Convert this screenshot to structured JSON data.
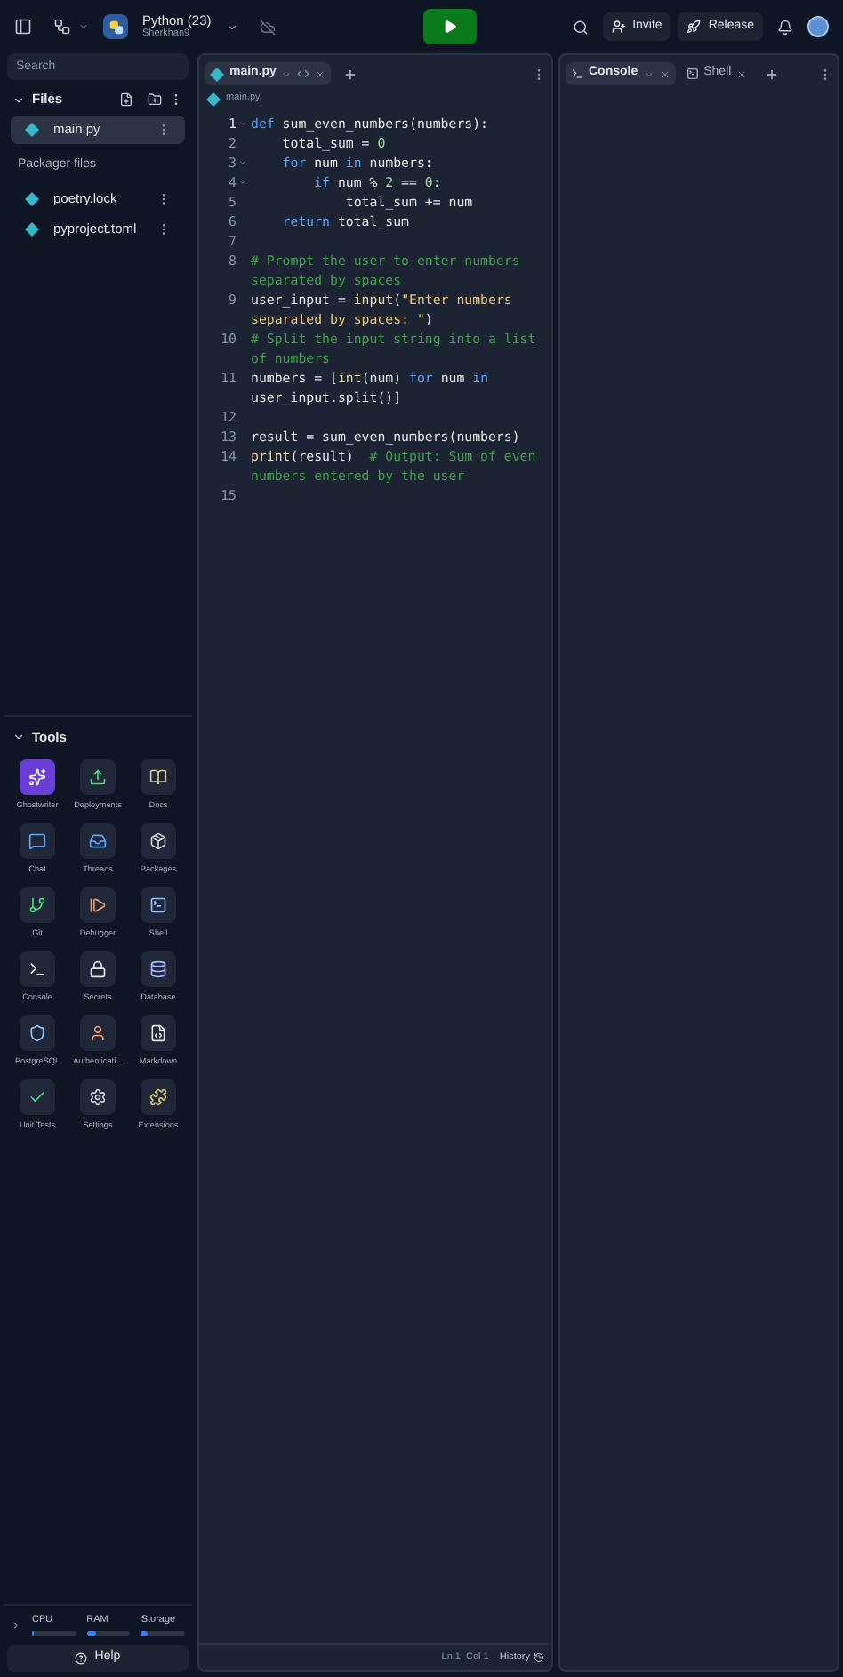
{
  "header": {
    "project_title": "Python (23)",
    "owner": "Sherkhan9",
    "buttons": [
      {
        "label": "Invite",
        "kind": "invite"
      },
      {
        "label": "Release",
        "kind": "release"
      }
    ]
  },
  "sidebar": {
    "search": {
      "placeholder": "Search"
    },
    "files_title": "Files",
    "files": [
      {
        "name": "main.py",
        "selected": true
      }
    ],
    "packager_title": "Packager files",
    "packager_files": [
      {
        "name": "poetry.lock",
        "selected": false
      },
      {
        "name": "pyproject.toml",
        "selected": false
      }
    ],
    "tools_title": "Tools",
    "tools": [
      {
        "label": "Ghostwriter",
        "kind": "ghost",
        "color": "#ffffff",
        "selected": true
      },
      {
        "label": "Deployments",
        "kind": "deploy",
        "color": "#4ade80",
        "selected": false
      },
      {
        "label": "Docs",
        "kind": "docs",
        "color": "#d6c9a0",
        "selected": false
      },
      {
        "label": "Chat",
        "kind": "chat",
        "color": "#60a5fa",
        "selected": false
      },
      {
        "label": "Threads",
        "kind": "threads",
        "color": "#60a5fa",
        "selected": false
      },
      {
        "label": "Packages",
        "kind": "packages",
        "color": "#d1d5db",
        "selected": false
      },
      {
        "label": "Git",
        "kind": "git",
        "color": "#4ade80",
        "selected": false
      },
      {
        "label": "Debugger",
        "kind": "debugger",
        "color": "#f59e6b",
        "selected": false
      },
      {
        "label": "Shell",
        "kind": "shell",
        "color": "#93c5fd",
        "selected": false
      },
      {
        "label": "Console",
        "kind": "console",
        "color": "#e5e7eb",
        "selected": false
      },
      {
        "label": "Secrets",
        "kind": "secrets",
        "color": "#e5e7eb",
        "selected": false
      },
      {
        "label": "Database",
        "kind": "database",
        "color": "#a5b4fc",
        "selected": false
      },
      {
        "label": "PostgreSQL",
        "kind": "postgres",
        "color": "#93c5fd",
        "selected": false
      },
      {
        "label": "Authenticati...",
        "kind": "auth",
        "color": "#f5a07a",
        "selected": false
      },
      {
        "label": "Markdown",
        "kind": "markdown",
        "color": "#e5e7eb",
        "selected": false
      },
      {
        "label": "Unit Tests",
        "kind": "tests",
        "color": "#4ade80",
        "selected": false
      },
      {
        "label": "Settings",
        "kind": "settings",
        "color": "#d1d5db",
        "selected": false
      },
      {
        "label": "Extensions",
        "kind": "extensions",
        "color": "#d6c97a",
        "selected": false
      }
    ],
    "resources": [
      {
        "label": "CPU",
        "level": 0.05
      },
      {
        "label": "RAM",
        "level": 0.2
      },
      {
        "label": "Storage",
        "level": 0.15
      }
    ],
    "help": "Help"
  },
  "editor": {
    "tabs": [
      {
        "label": "main.py",
        "selected": true
      }
    ],
    "breadcrumb": "main.py",
    "lines": [
      {
        "number": "1",
        "fold": true,
        "rows": [
          {
            "tokens": [
              {
                "kind": "keyword",
                "text": "def"
              },
              {
                "kind": "plain",
                "text": " sum_even_numbers(numbers):"
              }
            ]
          }
        ]
      },
      {
        "number": "2",
        "fold": false,
        "rows": [
          {
            "tokens": [
              {
                "kind": "plain",
                "text": "    total_sum = "
              },
              {
                "kind": "number",
                "text": "0"
              }
            ]
          }
        ]
      },
      {
        "number": "3",
        "fold": true,
        "rows": [
          {
            "tokens": [
              {
                "kind": "keyword",
                "text": "    for"
              },
              {
                "kind": "plain",
                "text": " num "
              },
              {
                "kind": "keyword",
                "text": "in"
              },
              {
                "kind": "plain",
                "text": " numbers:"
              }
            ]
          }
        ]
      },
      {
        "number": "4",
        "fold": true,
        "rows": [
          {
            "tokens": [
              {
                "kind": "keyword",
                "text": "        if"
              },
              {
                "kind": "plain",
                "text": " num % "
              },
              {
                "kind": "number",
                "text": "2"
              },
              {
                "kind": "plain",
                "text": " == "
              },
              {
                "kind": "number",
                "text": "0"
              },
              {
                "kind": "plain",
                "text": ":"
              }
            ]
          }
        ]
      },
      {
        "number": "5",
        "fold": false,
        "rows": [
          {
            "tokens": [
              {
                "kind": "plain",
                "text": "            total_sum += num"
              }
            ]
          }
        ]
      },
      {
        "number": "6",
        "fold": false,
        "rows": [
          {
            "tokens": [
              {
                "kind": "keyword",
                "text": "    return"
              },
              {
                "kind": "plain",
                "text": " total_sum"
              }
            ]
          }
        ]
      },
      {
        "number": "7",
        "fold": false
      },
      {
        "number": "8",
        "fold": false,
        "rows": [
          {
            "tokens": [
              {
                "kind": "comment",
                "text": "# Prompt the user to enter numbers"
              }
            ]
          },
          {
            "tokens": [
              {
                "kind": "comment",
                "text": "separated by spaces"
              }
            ]
          }
        ]
      },
      {
        "number": "9",
        "fold": false,
        "rows": [
          {
            "tokens": [
              {
                "kind": "plain",
                "text": "user_input = "
              },
              {
                "kind": "builtin",
                "text": "input"
              },
              {
                "kind": "plain",
                "text": "("
              },
              {
                "kind": "string",
                "text": "\"Enter numbers"
              }
            ]
          },
          {
            "tokens": [
              {
                "kind": "string",
                "text": "separated by spaces: \""
              },
              {
                "kind": "plain",
                "text": ")"
              }
            ]
          }
        ]
      },
      {
        "number": "10",
        "fold": false,
        "rows": [
          {
            "tokens": [
              {
                "kind": "comment",
                "text": "# Split the input string into a list"
              }
            ]
          },
          {
            "tokens": [
              {
                "kind": "comment",
                "text": "of numbers"
              }
            ]
          }
        ]
      },
      {
        "number": "11",
        "fold": false,
        "rows": [
          {
            "tokens": [
              {
                "kind": "plain",
                "text": "numbers = ["
              },
              {
                "kind": "builtin",
                "text": "int"
              },
              {
                "kind": "plain",
                "text": "(num) "
              },
              {
                "kind": "keyword",
                "text": "for"
              },
              {
                "kind": "plain",
                "text": " num "
              },
              {
                "kind": "keyword",
                "text": "in"
              }
            ]
          },
          {
            "tokens": [
              {
                "kind": "plain",
                "text": "user_input.split()]"
              }
            ]
          }
        ]
      },
      {
        "number": "12",
        "fold": false
      },
      {
        "number": "13",
        "fold": false,
        "rows": [
          {
            "tokens": [
              {
                "kind": "plain",
                "text": "result = sum_even_numbers(numbers)"
              }
            ]
          }
        ]
      },
      {
        "number": "14",
        "fold": false,
        "rows": [
          {
            "tokens": [
              {
                "kind": "builtin",
                "text": "print"
              },
              {
                "kind": "plain",
                "text": "(result)  "
              },
              {
                "kind": "comment",
                "text": "# Output: Sum of even"
              }
            ]
          },
          {
            "tokens": [
              {
                "kind": "comment",
                "text": "numbers entered by the user"
              }
            ]
          }
        ]
      },
      {
        "number": "15",
        "fold": false
      }
    ],
    "status": {
      "position": "Ln 1, Col 1",
      "history": "History"
    }
  },
  "console": {
    "tabs": [
      {
        "label": "Console",
        "kind": "console",
        "selected": true
      },
      {
        "label": "Shell",
        "kind": "shell",
        "selected": false
      }
    ]
  }
}
